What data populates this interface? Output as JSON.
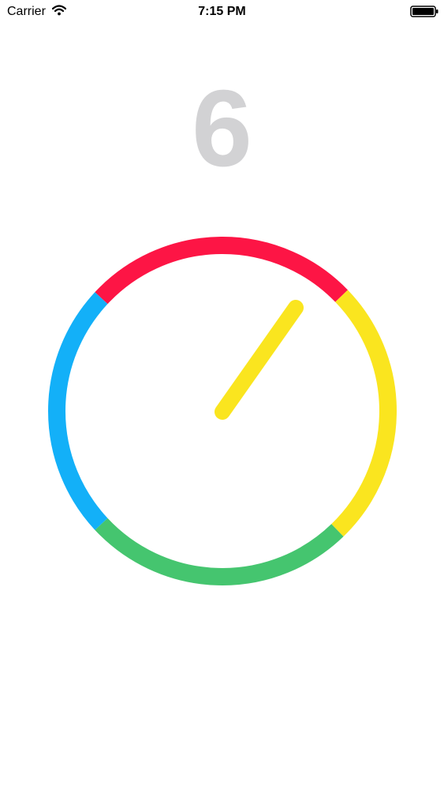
{
  "status_bar": {
    "carrier": "Carrier",
    "time": "7:15 PM",
    "wifi_icon": "wifi-icon",
    "battery_icon": "battery-icon"
  },
  "game": {
    "score": "6",
    "score_color": "#d2d2d4",
    "ring_segments": [
      {
        "name": "red",
        "color": "#fd1545"
      },
      {
        "name": "yellow",
        "color": "#fae51f"
      },
      {
        "name": "green",
        "color": "#45c56f"
      },
      {
        "name": "blue",
        "color": "#13b0f8"
      }
    ],
    "needle_color": "#fae51f",
    "needle_pointing_segment": "yellow"
  }
}
